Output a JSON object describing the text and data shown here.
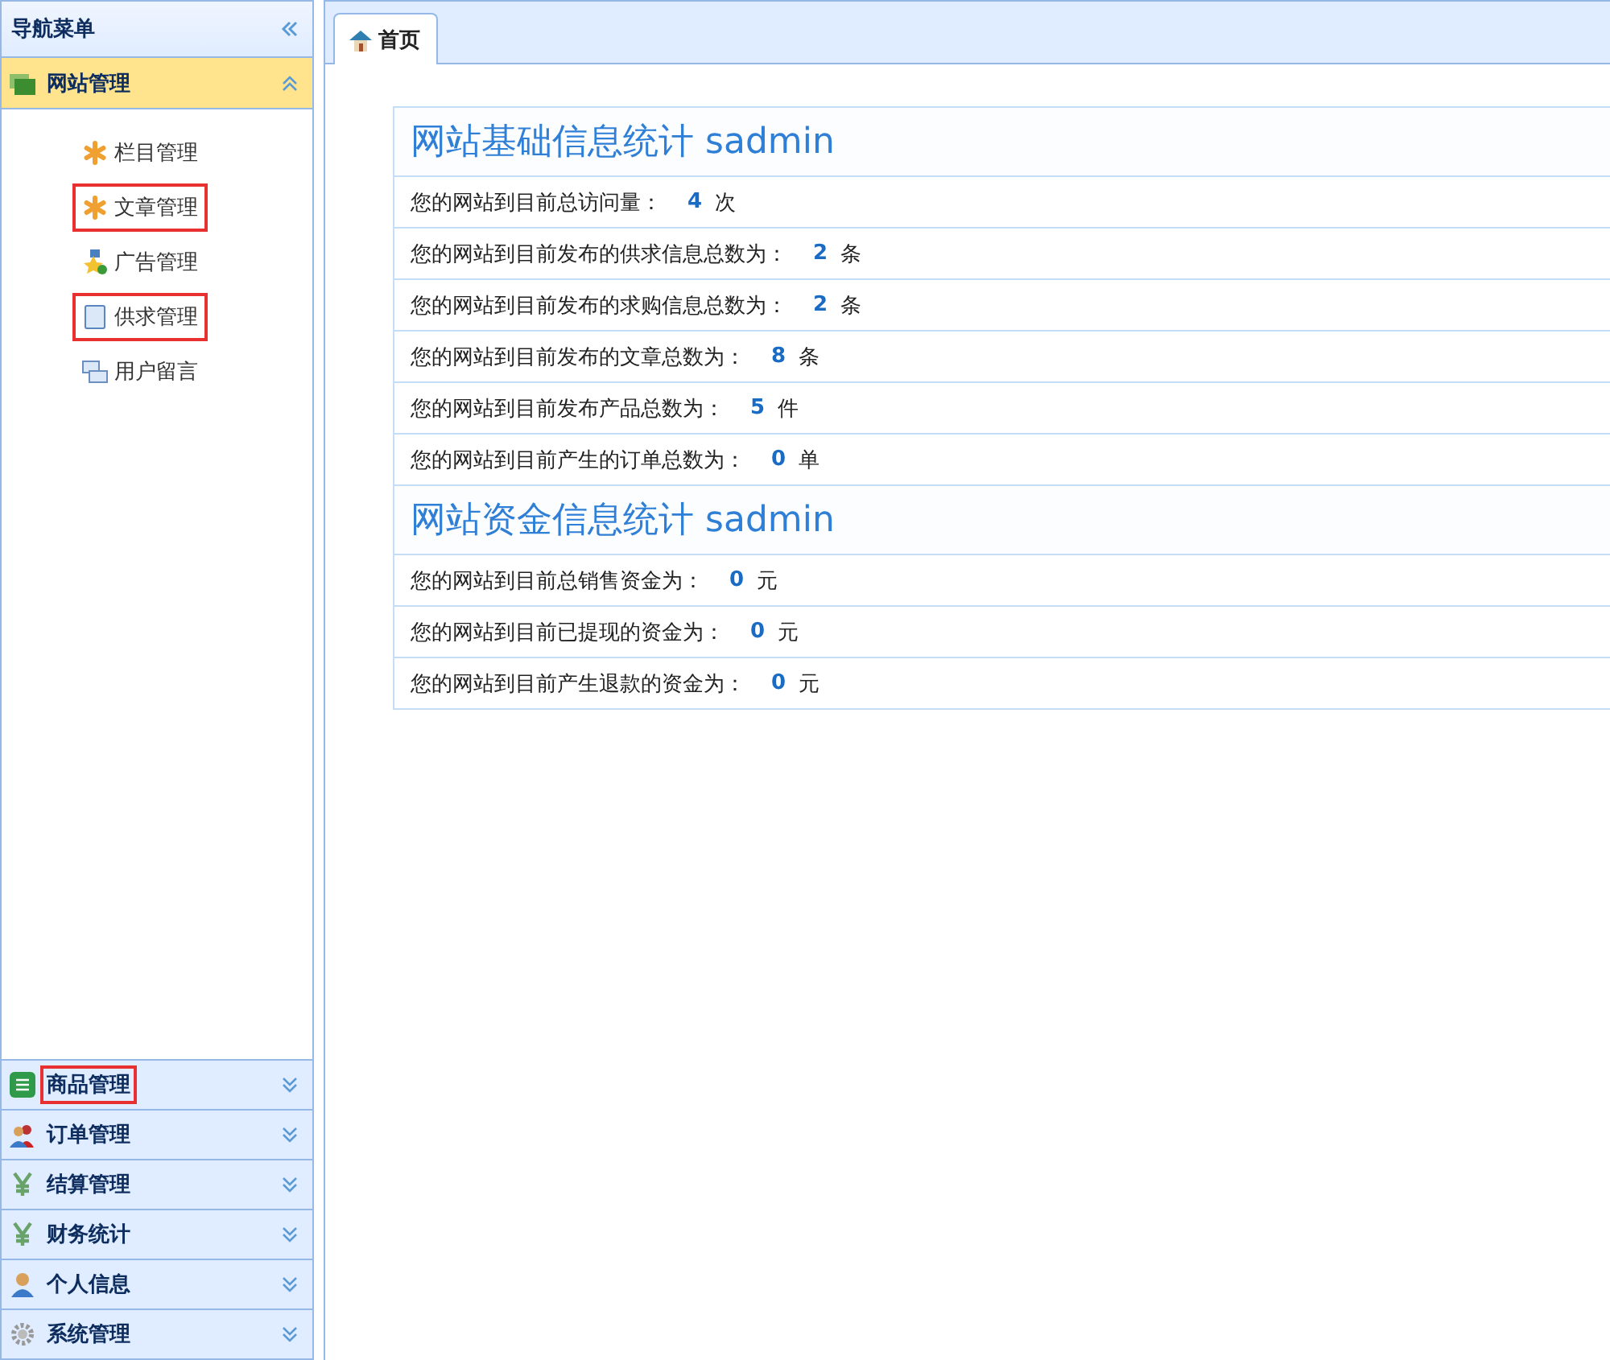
{
  "sidebar": {
    "title": "导航菜单",
    "open_section": {
      "label": "网站管理",
      "expanded": true,
      "items": [
        {
          "label": "栏目管理",
          "kind": "asterisk",
          "highlighted": false
        },
        {
          "label": "文章管理",
          "kind": "asterisk",
          "highlighted": true
        },
        {
          "label": "广告管理",
          "kind": "star",
          "highlighted": false
        },
        {
          "label": "供求管理",
          "kind": "page",
          "highlighted": true
        },
        {
          "label": "用户留言",
          "kind": "windows",
          "highlighted": false
        }
      ]
    },
    "sections": [
      {
        "label": "商品管理",
        "kind": "grid",
        "highlighted": true,
        "expanded": false
      },
      {
        "label": "订单管理",
        "kind": "users",
        "highlighted": false,
        "expanded": false
      },
      {
        "label": "结算管理",
        "kind": "yen",
        "highlighted": false,
        "expanded": false
      },
      {
        "label": "财务统计",
        "kind": "yen",
        "highlighted": false,
        "expanded": false
      },
      {
        "label": "个人信息",
        "kind": "user",
        "highlighted": false,
        "expanded": false
      },
      {
        "label": "系统管理",
        "kind": "gear",
        "highlighted": false,
        "expanded": false
      }
    ]
  },
  "tabs": [
    {
      "label": "首页",
      "selected": true
    }
  ],
  "panels": [
    {
      "title_text": "网站基础信息统计",
      "title_user": "sadmin",
      "rows": [
        {
          "label": "您的网站到目前总访问量：",
          "value": "4",
          "unit": "次"
        },
        {
          "label": "您的网站到目前发布的供求信息总数为：",
          "value": "2",
          "unit": "条"
        },
        {
          "label": "您的网站到目前发布的求购信息总数为：",
          "value": "2",
          "unit": "条"
        },
        {
          "label": "您的网站到目前发布的文章总数为：",
          "value": "8",
          "unit": "条"
        },
        {
          "label": "您的网站到目前发布产品总数为：",
          "value": "5",
          "unit": "件"
        },
        {
          "label": "您的网站到目前产生的订单总数为：",
          "value": "0",
          "unit": "单"
        }
      ]
    },
    {
      "title_text": "网站资金信息统计",
      "title_user": "sadmin",
      "rows": [
        {
          "label": "您的网站到目前总销售资金为：",
          "value": "0",
          "unit": "元"
        },
        {
          "label": "您的网站到目前已提现的资金为：",
          "value": "0",
          "unit": "元"
        },
        {
          "label": "您的网站到目前产生退款的资金为：",
          "value": "0",
          "unit": "元"
        }
      ]
    }
  ]
}
